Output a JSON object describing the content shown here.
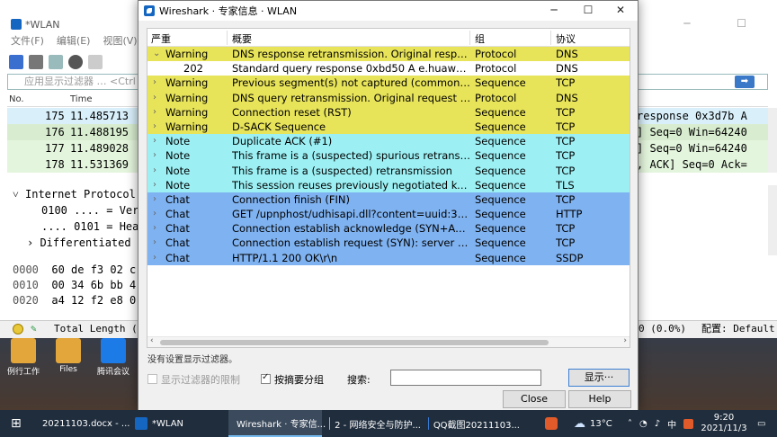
{
  "desktop": {
    "icons": [
      {
        "label": "例行工作",
        "color": "#e2a63a"
      },
      {
        "label": "Files",
        "color": "#e2a63a"
      },
      {
        "label": "腾讯会议",
        "color": "#1d7be8"
      }
    ]
  },
  "main_window": {
    "title": "*WLAN",
    "menu": [
      "文件(F)",
      "编辑(E)",
      "视图(V)"
    ],
    "filter_placeholder": "应用显示过滤器 … <Ctrl",
    "columns": {
      "no": "No.",
      "time": "Time"
    },
    "packets": [
      {
        "no": "175",
        "time": "11.485713",
        "rest": "response 0x3d7b A",
        "bg": "#d9f0fb"
      },
      {
        "no": "176",
        "time": "11.488195",
        "rest": "] Seq=0 Win=64240",
        "bg": "#d8edd0"
      },
      {
        "no": "177",
        "time": "11.489028",
        "rest": "] Seq=0 Win=64240",
        "bg": "#e4f5dd"
      },
      {
        "no": "178",
        "time": "11.531369",
        "rest": ", ACK] Seq=0 Ack=",
        "bg": "#e4f5dd"
      }
    ],
    "details": [
      "Internet Protocol",
      "0100 .... = Ver",
      ".... 0101 = Hea",
      "Differentiated"
    ],
    "hex": [
      {
        "offset": "0000",
        "bytes": "60 de f3 02 c"
      },
      {
        "offset": "0010",
        "bytes": "00 34 6b bb 4"
      },
      {
        "offset": "0020",
        "bytes": "a4 12 f2 e8 0"
      }
    ],
    "status_left": "Total Length (ip.",
    "status_right": "0 (0.0%)",
    "status_profile": "配置: Default"
  },
  "dialog": {
    "title": "Wireshark · 专家信息 · WLAN",
    "columns": {
      "severity": "严重",
      "summary": "概要",
      "group": "组",
      "protocol": "协议"
    },
    "rows": [
      {
        "expander": "⌄",
        "severity": "Warning",
        "summary": "DNS response retransmission. Original response i...",
        "group": "Protocol",
        "protocol": "DNS",
        "bg": "#e8e45a"
      },
      {
        "expander": "",
        "severity": "202",
        "summary": "Standard query response 0xbd50 A e.huawei.com...",
        "group": "Protocol",
        "protocol": "DNS",
        "bg": "#ffffff"
      },
      {
        "expander": "›",
        "severity": "Warning",
        "summary": "Previous segment(s) not captured (common at ca...",
        "group": "Sequence",
        "protocol": "TCP",
        "bg": "#e8e45a"
      },
      {
        "expander": "›",
        "severity": "Warning",
        "summary": "DNS query retransmission. Original request in fra...",
        "group": "Protocol",
        "protocol": "DNS",
        "bg": "#e8e45a"
      },
      {
        "expander": "›",
        "severity": "Warning",
        "summary": "Connection reset (RST)",
        "group": "Sequence",
        "protocol": "TCP",
        "bg": "#e8e45a"
      },
      {
        "expander": "›",
        "severity": "Warning",
        "summary": "D-SACK Sequence",
        "group": "Sequence",
        "protocol": "TCP",
        "bg": "#e8e45a"
      },
      {
        "expander": "›",
        "severity": "Note",
        "summary": "Duplicate ACK (#1)",
        "group": "Sequence",
        "protocol": "TCP",
        "bg": "#9cf0f4"
      },
      {
        "expander": "›",
        "severity": "Note",
        "summary": "This frame is a (suspected) spurious retransmission",
        "group": "Sequence",
        "protocol": "TCP",
        "bg": "#9cf0f4"
      },
      {
        "expander": "›",
        "severity": "Note",
        "summary": "This frame is a (suspected) retransmission",
        "group": "Sequence",
        "protocol": "TCP",
        "bg": "#9cf0f4"
      },
      {
        "expander": "›",
        "severity": "Note",
        "summary": "This session reuses previously negotiated keys (S...",
        "group": "Sequence",
        "protocol": "TLS",
        "bg": "#9cf0f4"
      },
      {
        "expander": "›",
        "severity": "Chat",
        "summary": "Connection finish (FIN)",
        "group": "Sequence",
        "protocol": "TCP",
        "bg": "#7fb2f0"
      },
      {
        "expander": "›",
        "severity": "Chat",
        "summary": "GET /upnphost/udhisapi.dll?content=uuid:33c73...",
        "group": "Sequence",
        "protocol": "HTTP",
        "bg": "#7fb2f0"
      },
      {
        "expander": "›",
        "severity": "Chat",
        "summary": "Connection establish acknowledge (SYN+ACK): s...",
        "group": "Sequence",
        "protocol": "TCP",
        "bg": "#7fb2f0"
      },
      {
        "expander": "›",
        "severity": "Chat",
        "summary": "Connection establish request (SYN): server port 2...",
        "group": "Sequence",
        "protocol": "TCP",
        "bg": "#7fb2f0"
      },
      {
        "expander": "›",
        "severity": "Chat",
        "summary": "HTTP/1.1 200 OK\\r\\n",
        "group": "Sequence",
        "protocol": "SSDP",
        "bg": "#7fb2f0"
      }
    ],
    "status": "没有设置显示过滤器。",
    "limit_filter_label": "显示过滤器的限制",
    "group_by_summary_label": "按摘要分组",
    "search_label": "搜索:",
    "search_value": "",
    "show_button": "显示···",
    "close_button": "Close",
    "help_button": "Help"
  },
  "taskbar": {
    "items": [
      {
        "label": "20211103.docx - ...",
        "color": "#2b5797"
      },
      {
        "label": "*WLAN",
        "color": "#1566c0"
      },
      {
        "label": "Wireshark · 专家信...",
        "color": "#1566c0"
      },
      {
        "label": "2 - 网络安全与防护...",
        "color": "#e2a63a"
      },
      {
        "label": "QQ截图20211103...",
        "color": "#3a7bd5"
      }
    ],
    "weather": "13°C",
    "ime": "中",
    "time": "9:20",
    "date": "2021/11/3"
  }
}
